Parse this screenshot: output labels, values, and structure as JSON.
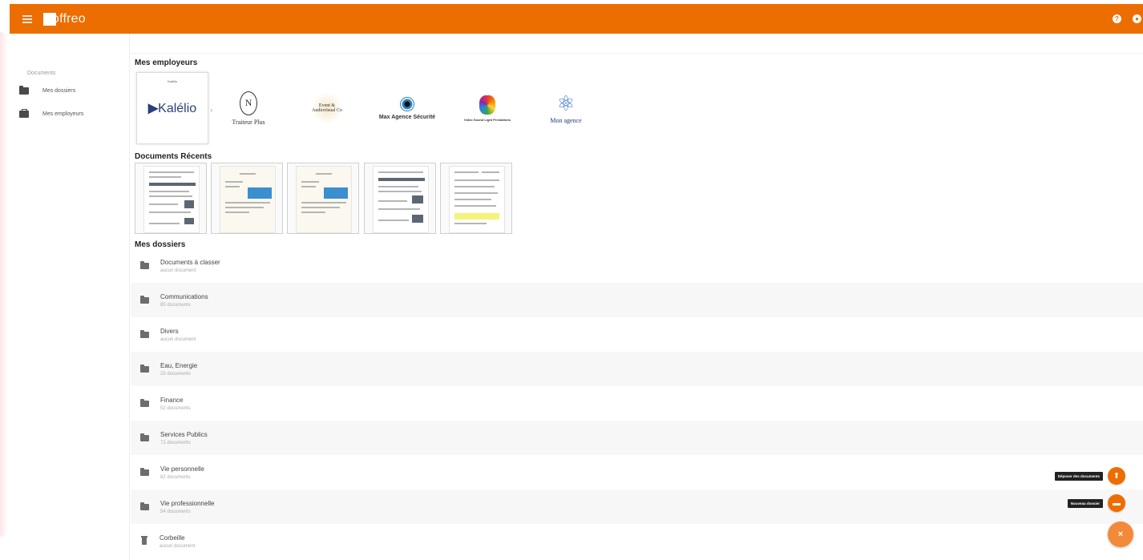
{
  "app": {
    "logo_text": "offreo"
  },
  "sidebar": {
    "heading": "Documents",
    "items": [
      {
        "label": "Mes dossiers",
        "icon": "folder-icon"
      },
      {
        "label": "Mes employeurs",
        "icon": "briefcase-icon"
      }
    ]
  },
  "employers": {
    "title": "Mes employeurs",
    "items": [
      {
        "name": "Kalélio",
        "small_text": "Kalélio"
      },
      {
        "name": "Traiteur Plus"
      },
      {
        "name": "Event & Audiovisual Co"
      },
      {
        "name": "Max Agence Sécurité"
      },
      {
        "name": "Video Sound Light Prestations"
      },
      {
        "name": "Mon agence"
      }
    ]
  },
  "recent_docs": {
    "title": "Documents Récents"
  },
  "folders": {
    "title": "Mes dossiers",
    "items": [
      {
        "name": "Documents à classer",
        "count": "aucun document"
      },
      {
        "name": "Communications",
        "count": "85 documents"
      },
      {
        "name": "Divers",
        "count": "aucun document"
      },
      {
        "name": "Eau, Energie",
        "count": "23 documents"
      },
      {
        "name": "Finance",
        "count": "52 documents"
      },
      {
        "name": "Services Publics",
        "count": "71 documents"
      },
      {
        "name": "Vie personnelle",
        "count": "82 documents"
      },
      {
        "name": "Vie professionnelle",
        "count": "54 documents"
      },
      {
        "name": "Corbeille",
        "count": "aucun document"
      }
    ]
  },
  "fab": {
    "upload_tooltip": "Déposer des documents",
    "new_folder_tooltip": "Nouveau dossier",
    "close_label": "×"
  },
  "colors": {
    "brand": "#ec6d00",
    "fab_main": "#f28a3a"
  }
}
